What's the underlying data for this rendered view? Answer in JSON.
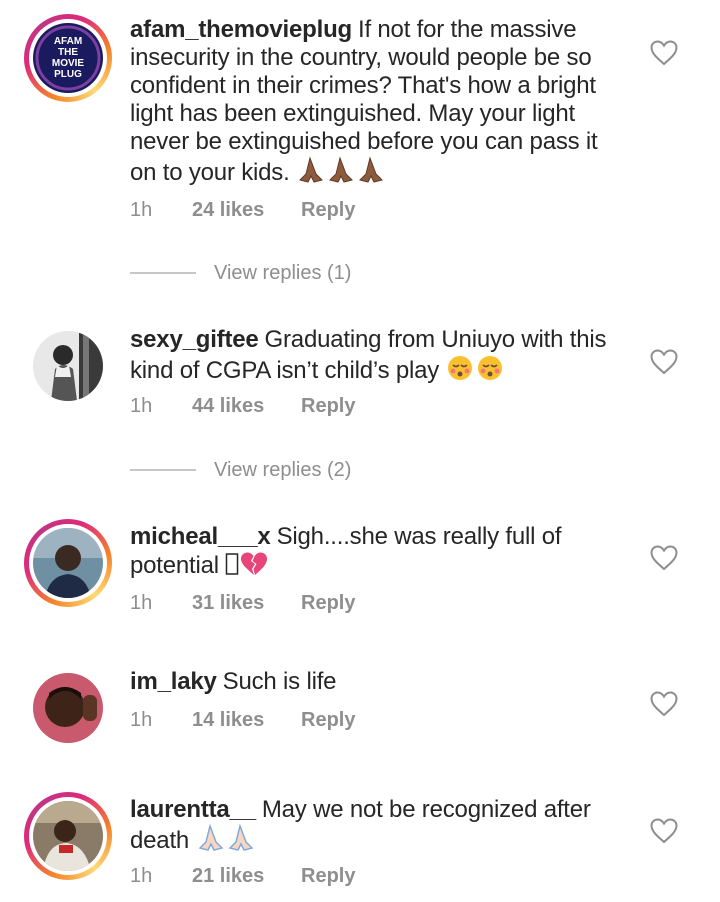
{
  "comments": [
    {
      "username": "afam_themovieplug",
      "text": "If not for the massive insecurity in the country, would people be so confident in their crimes? That's how a bright light has been extinguished. May your light never be extinguished before you can pass it on to your kids.",
      "time": "1h",
      "likes": "24 likes",
      "reply": "Reply",
      "view_replies": "View replies (1)",
      "avatar_text": [
        "AFAM",
        "THE",
        "MOVIE",
        "PLUG"
      ]
    },
    {
      "username": "sexy_giftee",
      "text": "Graduating from Uniuyo with this kind of CGPA isn’t child’s play",
      "time": "1h",
      "likes": "44 likes",
      "reply": "Reply",
      "view_replies": "View replies (2)"
    },
    {
      "username": "micheal___x",
      "text": "Sigh....she was really full of potential",
      "time": "1h",
      "likes": "31 likes",
      "reply": "Reply"
    },
    {
      "username": "im_laky",
      "text": "Such is life",
      "time": "1h",
      "likes": "14 likes",
      "reply": "Reply"
    },
    {
      "username": "laurentta__",
      "text": "May we not be recognized after death",
      "time": "1h",
      "likes": "21 likes",
      "reply": "Reply"
    }
  ],
  "icons": {
    "like": "heart-outline-icon",
    "pray_dark": "folded-hands-medium-dark-emoji",
    "pray_light": "folded-hands-light-emoji",
    "kissing": "kissing-face-closed-eyes-emoji",
    "broken_heart": "broken-heart-emoji",
    "missing_glyph": "missing-glyph"
  },
  "colors": {
    "text": "#262626",
    "meta": "#8e8e8e",
    "story_ring_start": "#f58529",
    "story_ring_end": "#c13584",
    "avatar_plug_bg": "#1a1a5e",
    "avatar_plug_ring": "#7b3fa0"
  }
}
